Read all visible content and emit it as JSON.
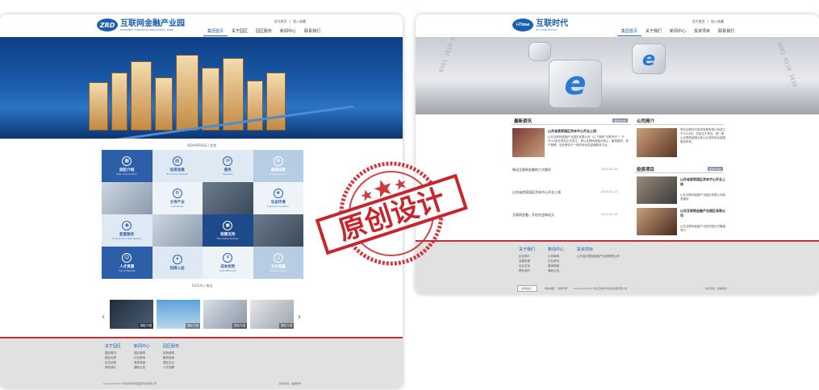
{
  "left": {
    "logo": {
      "mark": "ZRD",
      "cn": "互联网金融产业园",
      "en": "INTERNET FINANCIAL INDUSTRIAL PARK"
    },
    "toplinks": [
      "设为首页",
      "加入收藏"
    ],
    "nav": [
      "集团首页",
      "关于园区",
      "园区服务",
      "新闻中心",
      "联系我们"
    ],
    "advantage_title": "ADVANTAGE / 优势",
    "tiles": [
      {
        "t": "园区介绍",
        "s": "Park Introduction"
      },
      {
        "t": "投资发展",
        "s": "Economic Growth"
      },
      {
        "t": "服务",
        "s": "Services"
      },
      {
        "t": "基础设施",
        "s": "Infrastructure"
      },
      {
        "t": "主导产业",
        "s": "Industries"
      },
      {
        "t": "生态环境",
        "s": "Dynamic Location"
      },
      {
        "t": "配套服务",
        "s": "In Harmony with Nature"
      },
      {
        "t": "政策支持",
        "s": "Favorable Policies"
      },
      {
        "t": "人才资源",
        "s": "Full of Talents"
      },
      {
        "t": "招商入驻",
        "s": ""
      },
      {
        "t": "成本优势",
        "s": "Cost Effective"
      },
      {
        "t": "文化底蕴",
        "s": "Vibrant Culture"
      }
    ],
    "focus_title": "FOCUS / 焦点",
    "focus_items": [
      "园区介绍",
      "园区介绍",
      "园区介绍",
      "园区介绍"
    ],
    "footer": {
      "cols": [
        {
          "h": "关于园区",
          "items": [
            "园区概况",
            "园区优势",
            "区位优势",
            "联系我们"
          ]
        },
        {
          "h": "新闻中心",
          "items": [
            "园区新闻",
            "行业新闻",
            "媒体报道",
            "通知公告"
          ]
        },
        {
          "h": "园区服务",
          "items": [
            "招商政策",
            "服务指南",
            "园区企业",
            "人才招聘"
          ]
        }
      ],
      "copyright": "Copyright 2014 青岛中联智慧园区科技有限公司",
      "tech": "技术支持：金蝶软件"
    }
  },
  "right": {
    "logo": {
      "mark": "i-Time",
      "cn": "互联时代",
      "en": "HU LIAN SHIDAI"
    },
    "toplinks": [
      "设为首页",
      "加入收藏"
    ],
    "nav": [
      "集团首页",
      "关于我们",
      "新闻中心",
      "投资项目",
      "联系我们"
    ],
    "hero_letter": "e",
    "news": {
      "title": "最新资讯",
      "more": "更多MORE",
      "headline": "山东省首家园区资本中心开业上线",
      "summary": "山东互联网金融产业园区有限公司（以下简称“互联时代”）于2014年在青岛正式成立，是以互联网金融为核心，集投融资、资产管理、创业孵化于一体的综合性金融服务平台。",
      "items": [
        {
          "title": "移动互联网金融的六大模式",
          "date": "2014-02-20"
        },
        {
          "title": "山东省首家园区资本中心开业上线",
          "date": "2014-02-12"
        },
        {
          "title": "互联网金融，开启社会新纪元",
          "date": "2014-02-12"
        }
      ]
    },
    "about": {
      "title": "公司简介",
      "text": "青岛互联时代投资发展有限公司成立于2014年，总部位于青岛，是一家以互联网金融为核心业务的综合金融服务机构。"
    },
    "projects": {
      "title": "投资项目",
      "more": "更多MORE",
      "items": [
        {
          "title": "山东省首家园区资本中心开业上线",
          "text": "山东互联网金融产业园区有限公司投资建设"
        },
        {
          "title": "山东互联网金融产业园区有限公司",
          "text": "山东互联网金融产业园开园仪式隆重举行"
        }
      ]
    },
    "footer": {
      "cols": [
        {
          "h": "关于我们",
          "items": [
            "企业简介",
            "发展历程",
            "企业文化",
            "联系我们"
          ]
        },
        {
          "h": "新闻中心",
          "items": [
            "公司新闻",
            "行业资讯",
            "媒体报道",
            "通知公告"
          ]
        },
        {
          "h": "投资项目",
          "items": [
            "山东省互联网金融产业园有限公司"
          ]
        }
      ],
      "select": "-- 友情链接 --",
      "links": [
        "网站地图",
        "法律声明"
      ],
      "copyright": "Copyright 2014 青岛互联时代投资发展有限公司",
      "tech": "技术支持：金蝶软件"
    }
  },
  "stamp": {
    "text": "原创设计"
  }
}
